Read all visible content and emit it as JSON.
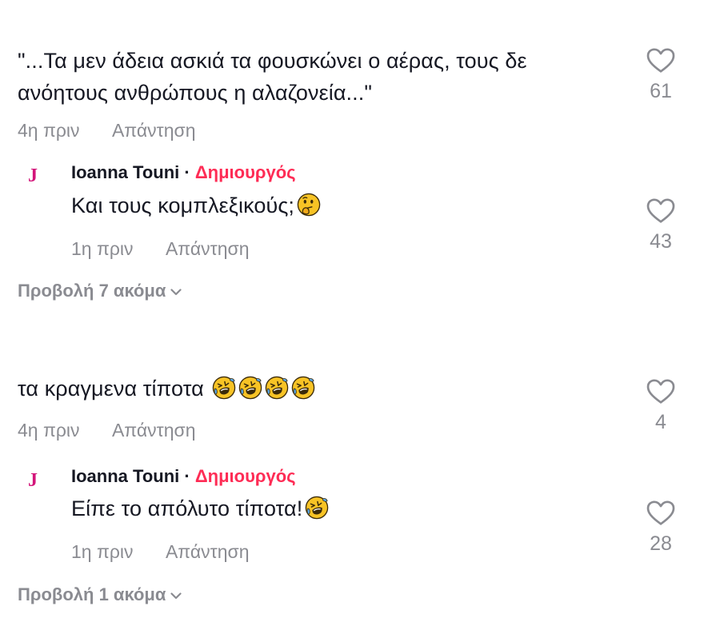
{
  "comments": [
    {
      "text": "\"...Τα μεν άδεια ασκιά τα φουσκώνει ο αέρας, τους δε",
      "text2": "ανόητους ανθρώπους η αλαζονεία...\"",
      "time": "4η πριν",
      "reply_label": "Απάντηση",
      "likes": "61",
      "reply": {
        "avatar": "J",
        "author": "Ioanna Touni",
        "separator": "·",
        "badge": "Δημιουργός",
        "text": "Και τους κομπλεξικούς;",
        "time": "1η πριν",
        "reply_label": "Απάντηση",
        "likes": "43"
      },
      "view_more": "Προβολή 7 ακόμα"
    },
    {
      "text": "τα κραγμενα τίποτα",
      "time": "4η πριν",
      "reply_label": "Απάντηση",
      "likes": "4",
      "reply": {
        "avatar": "J",
        "author": "Ioanna Touni",
        "separator": "·",
        "badge": "Δημιουργός",
        "text": "Είπε το απόλυτο τίποτα!",
        "time": "1η πριν",
        "reply_label": "Απάντηση",
        "likes": "28"
      },
      "view_more": "Προβολή 1 ακόμα"
    }
  ],
  "icons": {
    "like": "heart-outline-icon",
    "expand": "chevron-down-icon",
    "emoji_thinking": "thinking-face-emoji",
    "emoji_laughing": "rolling-on-floor-laughing-emoji"
  },
  "colors": {
    "text": "#161823",
    "muted": "#8a8b91",
    "creator_badge": "#fe2c55",
    "avatar": "#d3157a"
  }
}
